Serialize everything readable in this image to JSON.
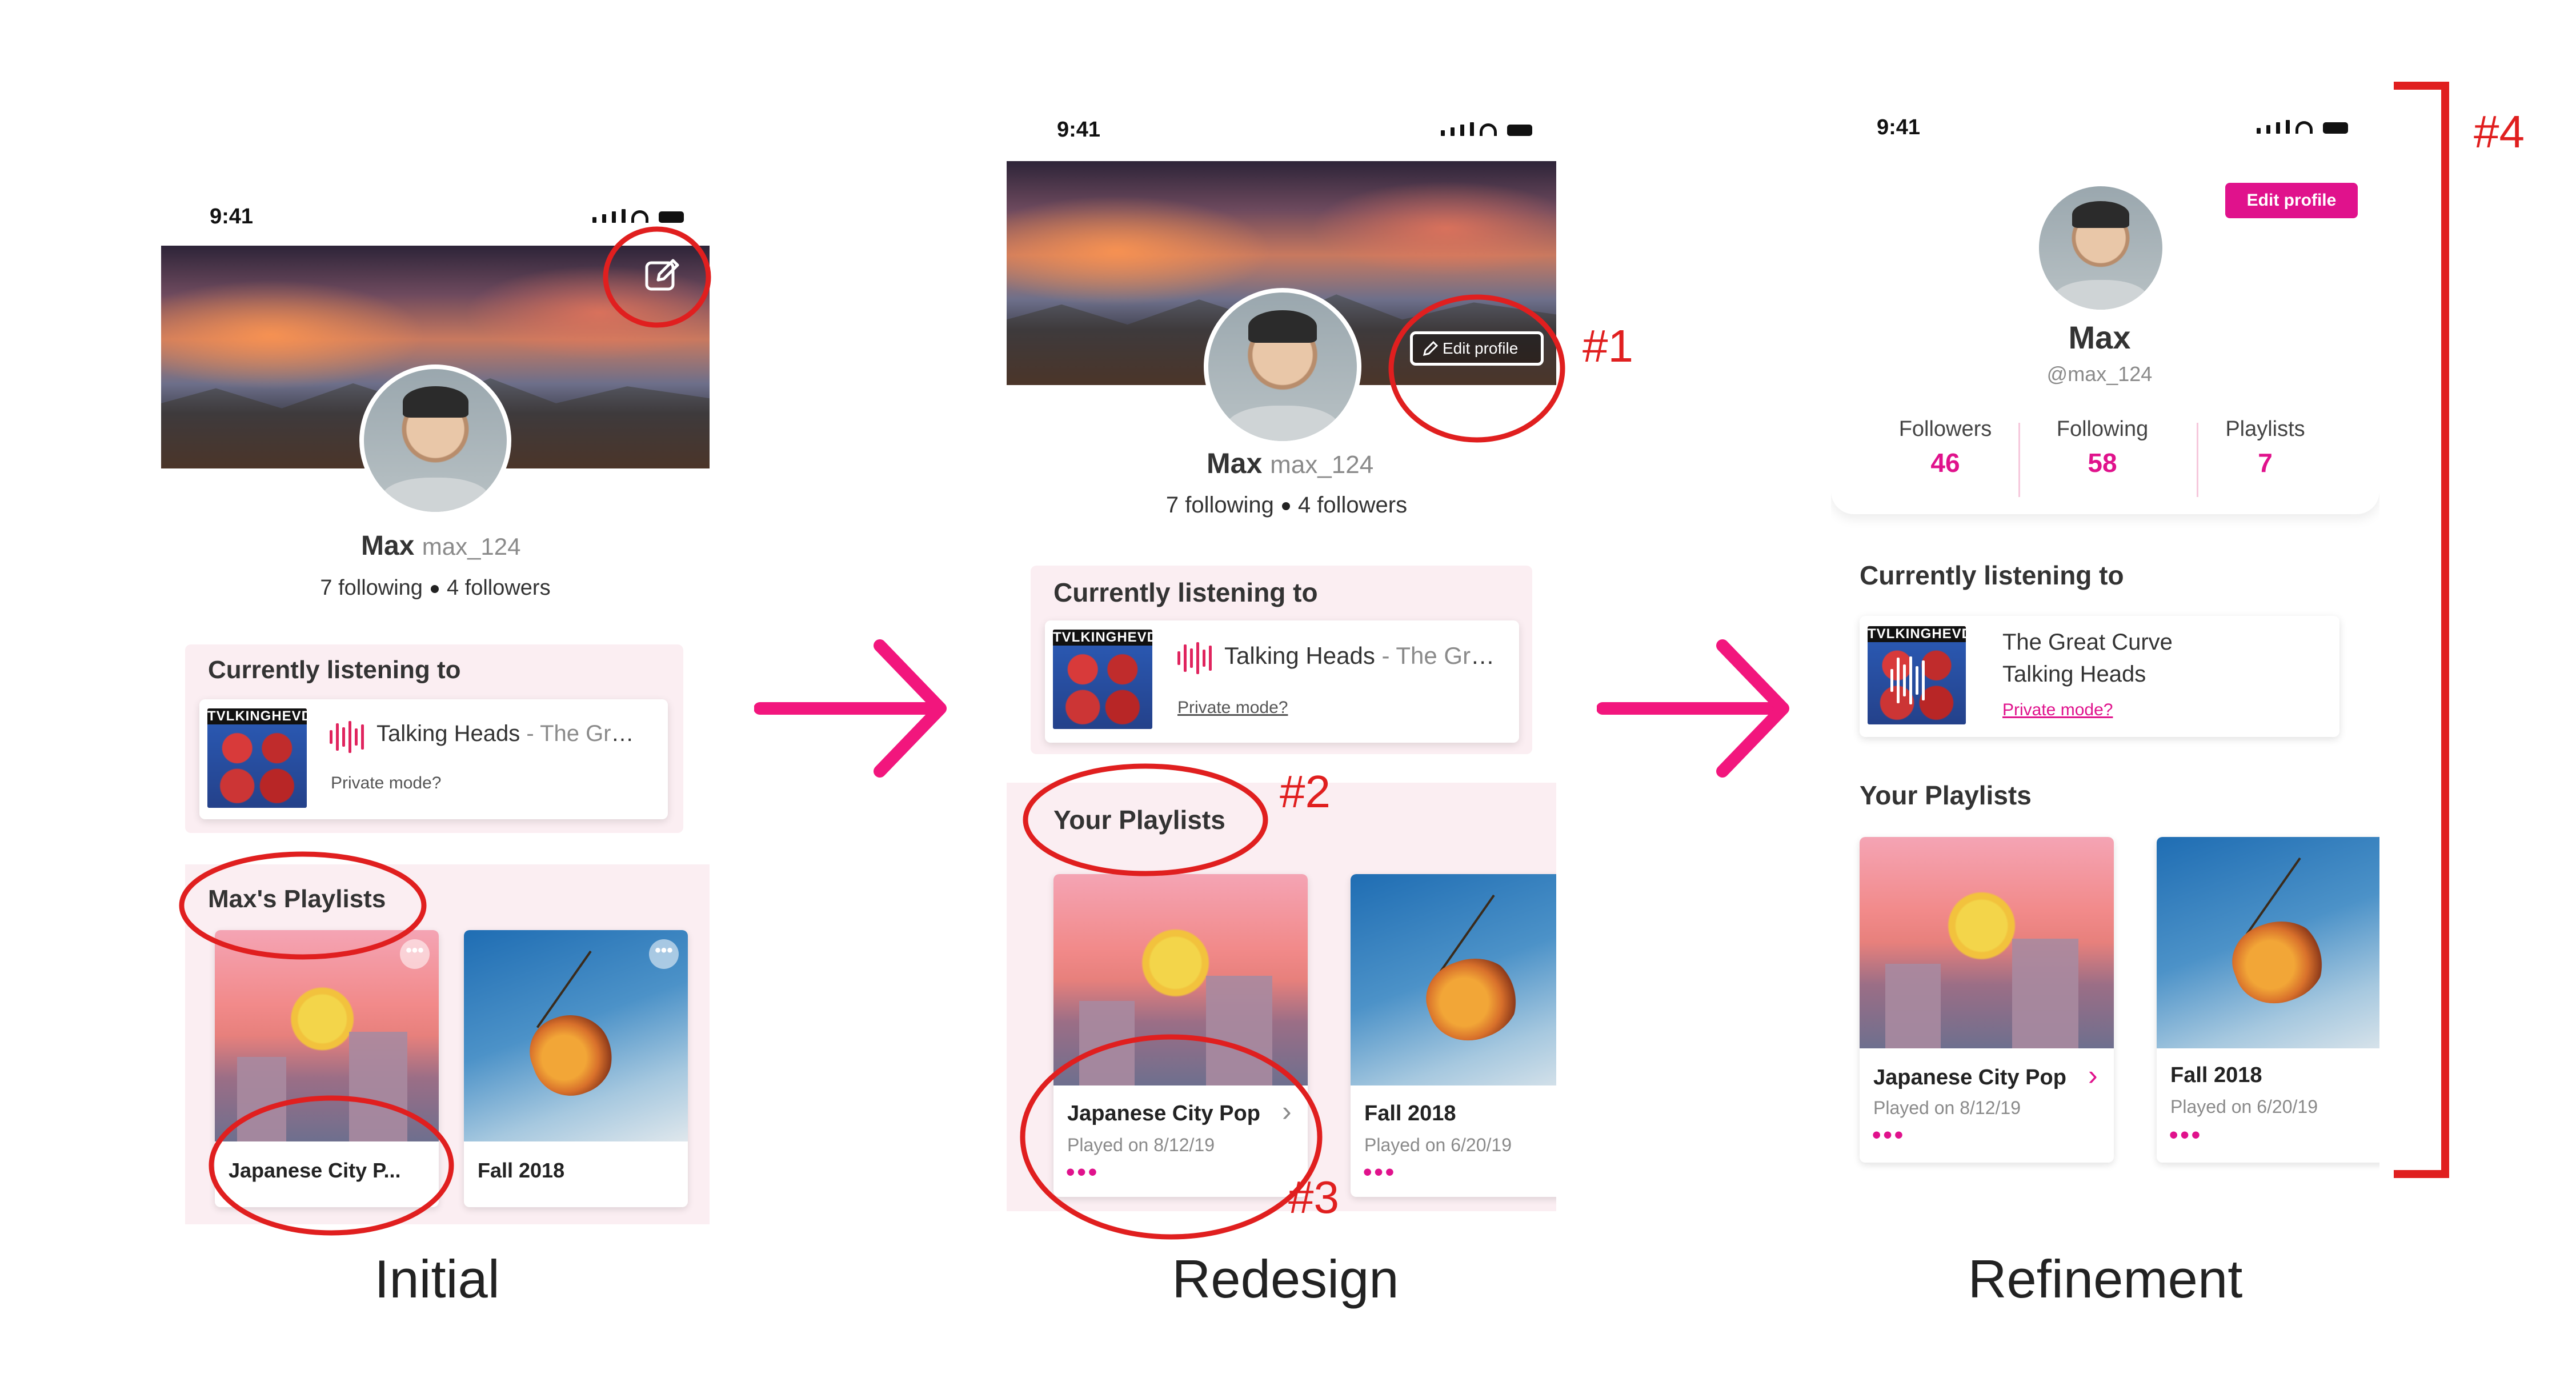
{
  "colors": {
    "accent_pink": "#e0128c",
    "annotation_red": "#e01f1f",
    "arrow_pink": "#f2167d",
    "section_bg": "#fbeef2"
  },
  "initial": {
    "status_time": "9:41",
    "edit_icon": "pencil-square-icon",
    "name": "Max",
    "handle": "max_124",
    "following": "7 following",
    "followers": "4 followers",
    "listening_title": "Currently listening to",
    "album_text": "TVLKINGHEVDS",
    "track_artist": "Talking Heads",
    "track_title": " - The Great Curve",
    "private_mode": "Private mode?",
    "playlists_title": "Max's Playlists",
    "playlists": [
      {
        "title": "Japanese City P..."
      },
      {
        "title": "Fall 2018"
      }
    ],
    "more_label": "•••",
    "caption": "Initial"
  },
  "redesign": {
    "status_time": "9:41",
    "edit_label": "Edit profile",
    "name": "Max",
    "handle": "max_124",
    "following": "7 following",
    "followers": "4 followers",
    "listening_title": "Currently listening to",
    "album_text": "TVLKINGHEVDS",
    "track_artist": "Talking Heads",
    "track_title": " - The Great Curve",
    "private_mode": "Private mode?",
    "playlists_title": "Your Playlists",
    "playlists": [
      {
        "title": "Japanese City Pop",
        "date": "Played on 8/12/19"
      },
      {
        "title": "Fall 2018",
        "date": "Played on 6/20/19"
      }
    ],
    "more_label": "•••",
    "caption": "Redesign"
  },
  "refinement": {
    "status_time": "9:41",
    "edit_label": "Edit profile",
    "name": "Max",
    "handle": "@max_124",
    "stats": [
      {
        "label": "Followers",
        "value": "46"
      },
      {
        "label": "Following",
        "value": "58"
      },
      {
        "label": "Playlists",
        "value": "7"
      }
    ],
    "listening_title": "Currently listening to",
    "album_text": "TVLKINGHEVDS",
    "track_title": "The Great Curve",
    "track_artist": "Talking Heads",
    "private_mode": "Private mode?",
    "playlists_title": "Your Playlists",
    "playlists": [
      {
        "title": "Japanese City Pop",
        "date": "Played on 8/12/19"
      },
      {
        "title": "Fall 2018",
        "date": "Played on 6/20/19"
      }
    ],
    "more_label": "•••",
    "caption": "Refinement"
  },
  "annotations": [
    "#1",
    "#2",
    "#3",
    "#4"
  ]
}
